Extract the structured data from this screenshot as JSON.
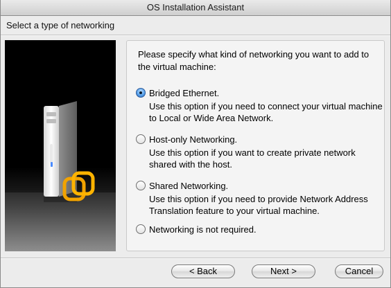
{
  "window": {
    "title": "OS Installation Assistant"
  },
  "header": {
    "subtitle": "Select a type of networking"
  },
  "panel": {
    "intro": "Please specify what kind of networking you want to add to the virtual machine:",
    "options": [
      {
        "label": "Bridged Ethernet.",
        "description": "Use this option if you need to connect your virtual machine to Local or Wide Area Network.",
        "selected": true
      },
      {
        "label": "Host-only Networking.",
        "description": "Use this option if you want to create private network shared with the host.",
        "selected": false
      },
      {
        "label": "Shared Networking.",
        "description": "Use this option if you need to provide Network Address Translation feature to your virtual machine.",
        "selected": false
      },
      {
        "label": "Networking is not required.",
        "description": "",
        "selected": false
      }
    ]
  },
  "buttons": {
    "back": "< Back",
    "next": "Next >",
    "cancel": "Cancel"
  },
  "colors": {
    "accent": "#3b7fd6",
    "logo": "#f2a300"
  }
}
